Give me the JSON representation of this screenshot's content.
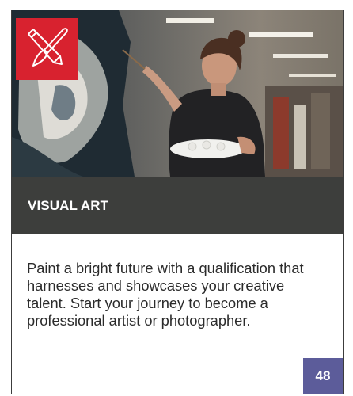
{
  "card": {
    "category_icon": "pencil-brush-cross-icon",
    "image_subject": "artist-painting-photo",
    "title": "VISUAL ART",
    "description": "Paint a bright future with a qualification that harnesses and showcases your creative talent. Start your journey to become a professional artist or photographer.",
    "course_count": "48"
  },
  "colors": {
    "badge_red": "#d8222f",
    "title_bar": "#3d3e3c",
    "count_badge": "#5c5c9a",
    "text": "#2b2b2b"
  }
}
